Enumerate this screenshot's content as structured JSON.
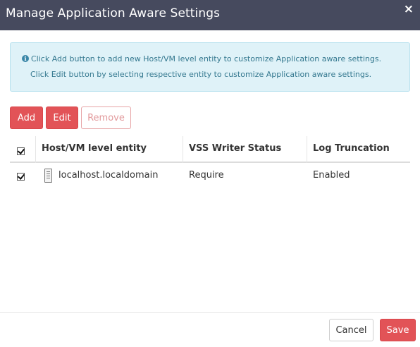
{
  "dialog": {
    "title": "Manage Application Aware Settings",
    "close_label": "×"
  },
  "info": {
    "icon": "info-circle-icon",
    "icon_glyph": "i",
    "line1": "Click Add button to add new Host/VM level entity to customize Application aware settings.",
    "line2": "Click Edit button by selecting respective entity to customize Application aware settings."
  },
  "toolbar": {
    "add_label": "Add",
    "edit_label": "Edit",
    "remove_label": "Remove"
  },
  "table": {
    "select_all_checked": true,
    "headers": [
      "Host/VM level entity",
      "VSS Writer Status",
      "Log Truncation"
    ],
    "rows": [
      {
        "checked": true,
        "icon": "server-icon",
        "entity": "localhost.localdomain",
        "vss_writer_status": "Require",
        "log_truncation": "Enabled"
      }
    ]
  },
  "footer": {
    "cancel_label": "Cancel",
    "save_label": "Save"
  },
  "colors": {
    "titlebar": "#464a5e",
    "accent_red": "#e25357",
    "info_bg": "#dff2f8",
    "info_text": "#34788f"
  }
}
